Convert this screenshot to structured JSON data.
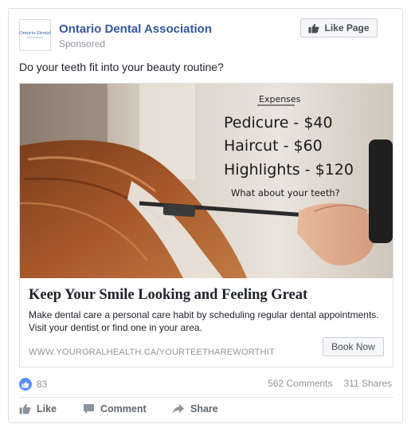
{
  "post": {
    "page_name": "Ontario Dental Association",
    "sponsored_label": "Sponsored",
    "avatar_logo_text": "Ontario Dental",
    "avatar_logo_sub": "ASSOCIATION",
    "like_page_label": "Like Page",
    "text": "Do your teeth fit into your beauty routine?"
  },
  "ad": {
    "image_text": {
      "heading": "Expenses",
      "line1": "Pedicure - $40",
      "line2": "Haircut - $60",
      "line3": "Highlights - $120",
      "question": "What about your teeth?"
    },
    "headline": "Keep Your Smile Looking and Feeling Great",
    "description": "Make dental care a personal care habit by scheduling regular dental appointments. Visit your dentist or find one in your area.",
    "display_url": "WWW.YOURORALHEALTH.CA/YOURTEETHAREWORTHIT",
    "cta_label": "Book Now"
  },
  "engagement": {
    "likes": "83",
    "comments": "562 Comments",
    "shares": "311 Shares"
  },
  "actions": {
    "like_label": "Like",
    "comment_label": "Comment",
    "share_label": "Share"
  },
  "colors": {
    "page_name": "#365899",
    "like_bubble": "#5890ff",
    "muted_text": "#90949c"
  },
  "icons": {
    "like_page": "thumbs-up-icon",
    "reaction": "like-reaction-icon",
    "like": "thumbs-up-icon",
    "comment": "comment-bubble-icon",
    "share": "share-arrow-icon"
  }
}
